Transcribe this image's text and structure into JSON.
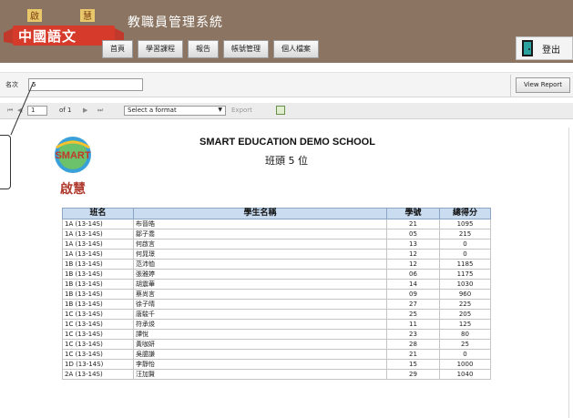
{
  "header": {
    "app_title": "教職員管理系統",
    "logo_text": "中國語文",
    "nav": [
      "首頁",
      "學習課程",
      "報告",
      "帳號管理",
      "個人檔案"
    ],
    "logout_label": "登出"
  },
  "params": {
    "label": "名次",
    "value": "5",
    "view_report_label": "View Report"
  },
  "toolbar": {
    "first_icon": "first-page-icon",
    "prev_icon": "prev-page-icon",
    "page_value": "1",
    "page_of": "of 1",
    "next_icon": "next-page-icon",
    "last_icon": "last-page-icon",
    "format_value": "Select a format",
    "export_label": "Export",
    "refresh_icon": "refresh-icon"
  },
  "report": {
    "logo_text": "SMART",
    "logo_subtitle": "啟慧",
    "school_name": "SMART EDUCATION DEMO SCHOOL",
    "title": "班頭 5 位",
    "columns": [
      "班名",
      "學生名稱",
      "學號",
      "總得分"
    ],
    "rows": [
      [
        "1A (13-14S)",
        "布晉皓",
        "21",
        "1095"
      ],
      [
        "1A (13-14S)",
        "鄒子喬",
        "05",
        "215"
      ],
      [
        "1A (13-14S)",
        "何啟言",
        "13",
        "0"
      ],
      [
        "1A (13-14S)",
        "何晁璟",
        "12",
        "0"
      ],
      [
        "1B (13-14S)",
        "范沛恤",
        "12",
        "1185"
      ],
      [
        "1B (13-14S)",
        "張雅婷",
        "06",
        "1175"
      ],
      [
        "1B (13-14S)",
        "胡震華",
        "14",
        "1030"
      ],
      [
        "1B (13-14S)",
        "蔡尚言",
        "09",
        "960"
      ],
      [
        "1B (13-14S)",
        "徐子晴",
        "27",
        "225"
      ],
      [
        "1C (13-14S)",
        "唐駿千",
        "25",
        "205"
      ],
      [
        "1C (13-14S)",
        "符承焌",
        "11",
        "125"
      ],
      [
        "1C (13-14S)",
        "譚悅",
        "23",
        "80"
      ],
      [
        "1C (13-14S)",
        "黃咖妍",
        "28",
        "25"
      ],
      [
        "1C (13-14S)",
        "吳臆謙",
        "21",
        "0"
      ],
      [
        "1D (13-14S)",
        "李靜怡",
        "15",
        "1000"
      ],
      [
        "2A (13-14S)",
        "汪加賢",
        "29",
        "1040"
      ]
    ]
  },
  "colors": {
    "header_bg": "#8b7562",
    "table_header_bg": "#c9dcf0",
    "logo_red": "#c0392b"
  }
}
